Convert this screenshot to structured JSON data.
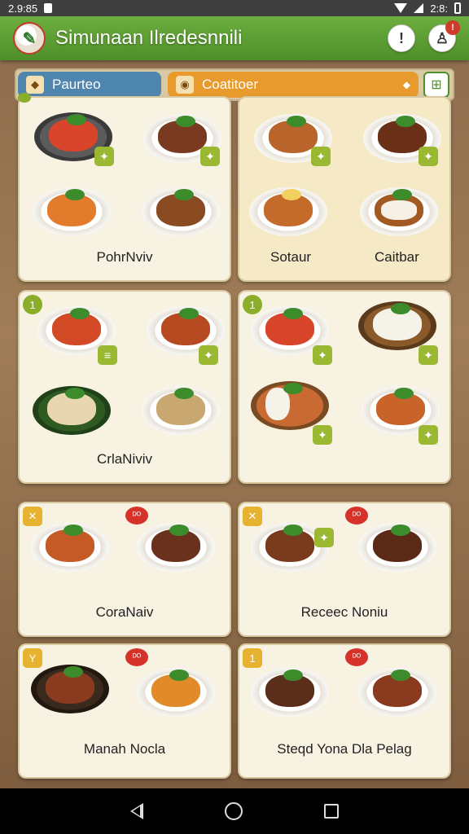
{
  "status_bar": {
    "time": "2.9:85",
    "right_text": "2:8:",
    "icons": [
      "notification-icon",
      "wifi-icon",
      "signal-icon",
      "battery-icon"
    ]
  },
  "app_bar": {
    "title": "Simunaan Ilredesnnili",
    "logo_icon": "restaurant-logo-icon",
    "info_button": "!",
    "profile_badge": "!"
  },
  "filters": {
    "popular_label": "Paurteo",
    "category_label": "Coatitoer",
    "category_caret": "◆",
    "grid_icon": "grid-view-icon"
  },
  "cards": [
    {
      "label": "PohrNviv",
      "tags": [
        "",
        "✦",
        "✦"
      ],
      "corner": ""
    },
    {
      "label_left": "Sotaur",
      "label_right": "Caitbar",
      "tags": [
        "✦",
        "✦"
      ]
    },
    {
      "label": "CrlaNiviv",
      "tags": [
        "≡",
        "✦"
      ],
      "corner": "1"
    },
    {
      "label": "",
      "tags": [
        "✦",
        "✦",
        "✦"
      ],
      "corner": "1"
    },
    {
      "label": "CoraNaiv",
      "corner": "✕",
      "promo": "ᴰᴼ"
    },
    {
      "label": "Receec Noniu",
      "corner": "✕",
      "promo": "ᴰᴼ",
      "tags": [
        "✦"
      ]
    },
    {
      "label": "Manah Nocla",
      "corner": "Y",
      "promo": "ᴰᴼ"
    },
    {
      "label": "Steqd Yona Dla Pelag",
      "corner": "1",
      "promo": "ᴰᴼ"
    }
  ],
  "colors": {
    "app_bar": "#4f8f2a",
    "popular_chip": "#4f86b0",
    "category_chip": "#e89a2c",
    "tag_green": "#9ab832",
    "promo_red": "#d5322a"
  },
  "nav": {
    "back_icon": "back-triangle-icon",
    "home_icon": "home-circle-icon",
    "recents_icon": "recents-square-icon"
  }
}
